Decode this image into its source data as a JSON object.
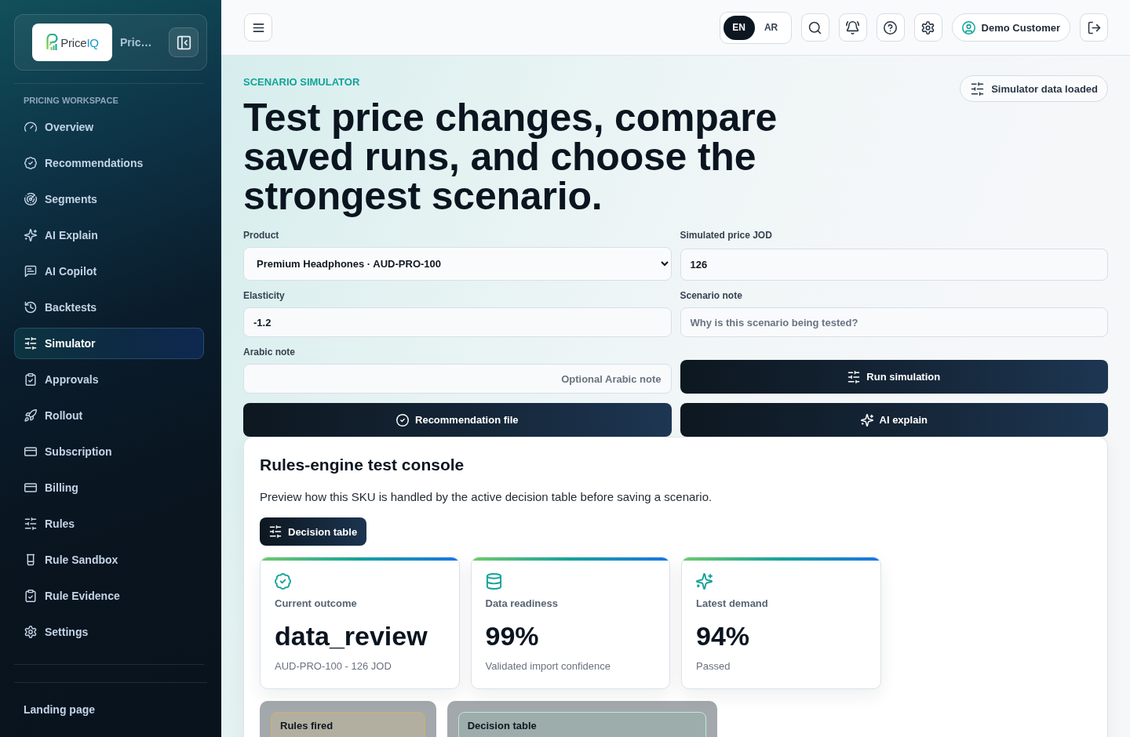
{
  "sidebar": {
    "brand": {
      "logo": {
        "wordmark": "Price",
        "accent": "IQ"
      },
      "name": "Pric…"
    },
    "section_label": "PRICING WORKSPACE",
    "items": [
      {
        "label": "Overview",
        "selected": false
      },
      {
        "label": "Recommendations",
        "selected": false
      },
      {
        "label": "Segments",
        "selected": false
      },
      {
        "label": "AI Explain",
        "selected": false
      },
      {
        "label": "AI Copilot",
        "selected": false
      },
      {
        "label": "Backtests",
        "selected": false
      },
      {
        "label": "Simulator",
        "selected": true
      },
      {
        "label": "Approvals",
        "selected": false
      },
      {
        "label": "Rollout",
        "selected": false
      },
      {
        "label": "Subscription",
        "selected": false
      },
      {
        "label": "Billing",
        "selected": false
      },
      {
        "label": "Rules",
        "selected": false
      },
      {
        "label": "Rule Sandbox",
        "selected": false
      },
      {
        "label": "Rule Evidence",
        "selected": false
      },
      {
        "label": "Settings",
        "selected": false
      }
    ],
    "footer_link": "Landing page"
  },
  "top_bar": {
    "languages": [
      {
        "label": "EN",
        "selected": true
      },
      {
        "label": "AR",
        "selected": false
      }
    ],
    "user": "Demo Customer"
  },
  "header": {
    "eyebrow": "SCENARIO SIMULATOR",
    "title": "Test price changes, compare saved runs, and choose the strongest scenario.",
    "status_badge": "Simulator data loaded"
  },
  "form": {
    "fields": [
      {
        "kind": "select",
        "label": "Product",
        "value": "Premium Headphones · AUD-PRO-100"
      },
      {
        "kind": "input",
        "label": "Simulated price JOD",
        "value": "126"
      },
      {
        "kind": "input",
        "label": "Elasticity",
        "value": "-1.2"
      },
      {
        "kind": "input",
        "label": "Scenario note",
        "placeholder": "Why is this scenario being tested?"
      },
      {
        "kind": "input",
        "label": "Arabic note",
        "placeholder": "Optional Arabic note",
        "rtl": true
      }
    ],
    "actions": [
      {
        "label": "Run simulation"
      },
      {
        "label": "Recommendation file"
      },
      {
        "label": "AI explain"
      }
    ]
  },
  "console": {
    "title": "Rules-engine test console",
    "description": "Preview how this SKU is handled by the active decision table before saving a scenario.",
    "button": "Decision table",
    "stats": [
      {
        "label": "Current outcome",
        "value": "data_review",
        "note": "AUD-PRO-100 - 126 JOD"
      },
      {
        "label": "Data readiness",
        "value": "99%",
        "note": "Validated import confidence"
      },
      {
        "label": "Latest demand",
        "value": "94%",
        "note": "Passed"
      }
    ],
    "panels": [
      {
        "kind": "warning",
        "title": "Rules fired"
      },
      {
        "kind": "success",
        "title": "Decision table"
      }
    ]
  }
}
